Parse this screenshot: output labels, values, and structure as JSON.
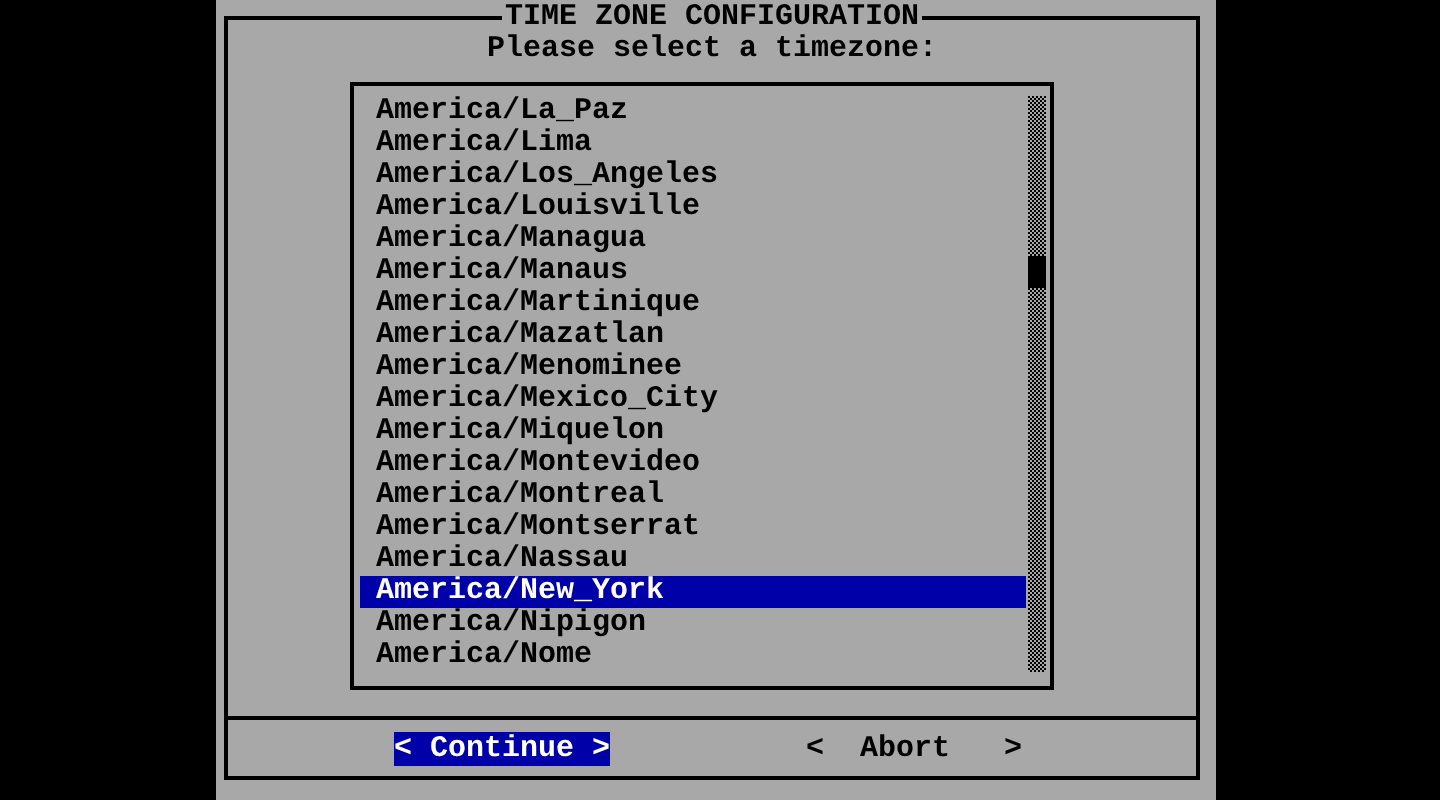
{
  "dialog": {
    "title": "TIME ZONE CONFIGURATION",
    "prompt": "Please select a timezone:"
  },
  "timezones": [
    {
      "label": "America/La_Paz",
      "selected": false
    },
    {
      "label": "America/Lima",
      "selected": false
    },
    {
      "label": "America/Los_Angeles",
      "selected": false
    },
    {
      "label": "America/Louisville",
      "selected": false
    },
    {
      "label": "America/Managua",
      "selected": false
    },
    {
      "label": "America/Manaus",
      "selected": false
    },
    {
      "label": "America/Martinique",
      "selected": false
    },
    {
      "label": "America/Mazatlan",
      "selected": false
    },
    {
      "label": "America/Menominee",
      "selected": false
    },
    {
      "label": "America/Mexico_City",
      "selected": false
    },
    {
      "label": "America/Miquelon",
      "selected": false
    },
    {
      "label": "America/Montevideo",
      "selected": false
    },
    {
      "label": "America/Montreal",
      "selected": false
    },
    {
      "label": "America/Montserrat",
      "selected": false
    },
    {
      "label": "America/Nassau",
      "selected": false
    },
    {
      "label": "America/New_York",
      "selected": true
    },
    {
      "label": "America/Nipigon",
      "selected": false
    },
    {
      "label": "America/Nome",
      "selected": false
    }
  ],
  "buttons": [
    {
      "label": "< Continue >",
      "selected": true
    },
    {
      "label": "<  Abort   >",
      "selected": false
    }
  ]
}
